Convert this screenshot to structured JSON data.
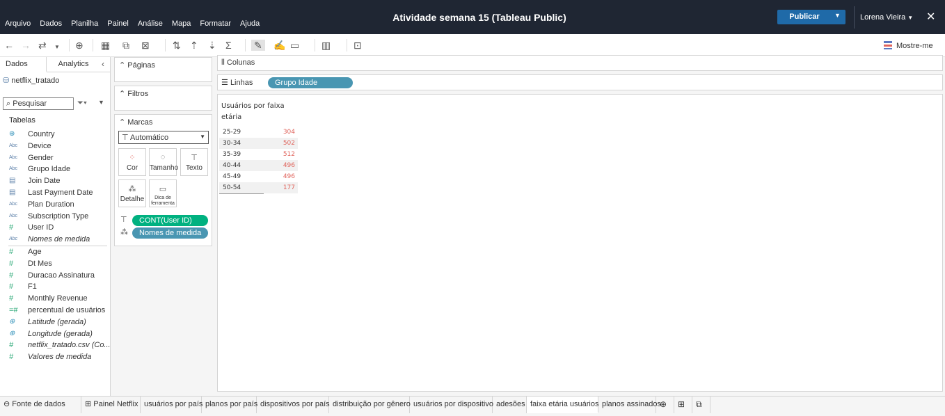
{
  "titlebar": {
    "menu": [
      "Arquivo",
      "Dados",
      "Planilha",
      "Painel",
      "Análise",
      "Mapa",
      "Formatar",
      "Ajuda"
    ],
    "title": "Atividade semana 15 (Tableau Public)",
    "publish": "Publicar",
    "user": "Lorena Vieira",
    "close": "✕"
  },
  "toolbar": {
    "show_me": "Mostre-me"
  },
  "datapane": {
    "tab_data": "Dados",
    "tab_analytics": "Analytics",
    "datasource": "netflix_tratado",
    "search_placeholder": "Pesquisar",
    "tables_heading": "Tabelas",
    "dimensions": [
      {
        "label": "Country",
        "type": "globe"
      },
      {
        "label": "Device",
        "type": "abc"
      },
      {
        "label": "Gender",
        "type": "abc"
      },
      {
        "label": "Grupo Idade",
        "type": "abc"
      },
      {
        "label": "Join Date",
        "type": "calendar"
      },
      {
        "label": "Last Payment Date",
        "type": "calendar"
      },
      {
        "label": "Plan Duration",
        "type": "abc"
      },
      {
        "label": "Subscription Type",
        "type": "abc"
      },
      {
        "label": "User ID",
        "type": "number"
      },
      {
        "label": "Nomes de medida",
        "type": "abc",
        "italic": true
      }
    ],
    "measures": [
      {
        "label": "Age",
        "type": "number"
      },
      {
        "label": "Dt Mes",
        "type": "number"
      },
      {
        "label": "Duracao Assinatura",
        "type": "number"
      },
      {
        "label": "F1",
        "type": "number"
      },
      {
        "label": "Monthly Revenue",
        "type": "number"
      },
      {
        "label": "percentual de usuários",
        "type": "calc-number"
      },
      {
        "label": "Latitude (gerada)",
        "type": "globe",
        "italic": true
      },
      {
        "label": "Longitude (gerada)",
        "type": "globe",
        "italic": true
      },
      {
        "label": "netflix_tratado.csv (Co...",
        "type": "number",
        "italic": true
      },
      {
        "label": "Valores de medida",
        "type": "number",
        "italic": true
      }
    ]
  },
  "cards": {
    "pages": "Páginas",
    "filters": "Filtros",
    "marks": "Marcas",
    "mark_type": "Automático",
    "buttons": {
      "color": "Cor",
      "size": "Tamanho",
      "text": "Texto",
      "detail": "Detalhe",
      "tooltip": "Dica de ferramenta"
    },
    "pill_text": "CONT(User ID)",
    "pill_detail": "Nomes de medida"
  },
  "shelves": {
    "columns": "Colunas",
    "rows": "Linhas",
    "rows_pill": "Grupo Idade"
  },
  "view": {
    "title": "Usuários por faixa etária",
    "rows": [
      {
        "label": "25-29",
        "value": "304"
      },
      {
        "label": "30-34",
        "value": "502"
      },
      {
        "label": "35-39",
        "value": "512"
      },
      {
        "label": "40-44",
        "value": "496"
      },
      {
        "label": "45-49",
        "value": "496"
      },
      {
        "label": "50-54",
        "value": "177"
      }
    ]
  },
  "sheet_tabs": {
    "datasource": "Fonte de dados",
    "tabs": [
      "Painel Netflix",
      "usuários por país",
      "planos por país",
      "dispositivos por país",
      "distribuição por gênero",
      "usuários por dispositivo",
      "adesões",
      "faixa etária usuários",
      "planos assinados"
    ],
    "active": "faixa etária usuários"
  },
  "colors": {
    "titlebar": "#1f2633",
    "publish": "#1f6aa8",
    "green_pill": "#00b180",
    "blue_pill": "#4996b2",
    "value_red": "#e0645c"
  }
}
